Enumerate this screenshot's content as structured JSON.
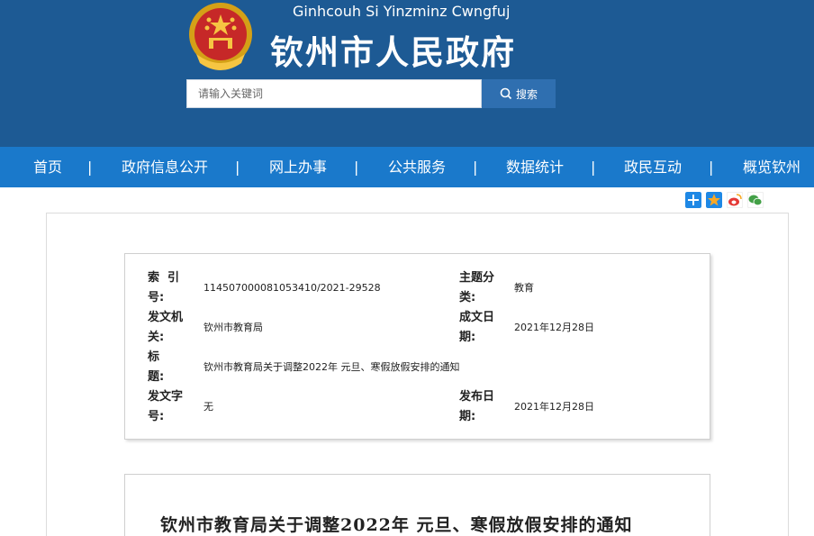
{
  "header": {
    "site_name_en": "Ginhcouh Si Yinzminz Cwngfuj",
    "site_name_cn": "钦州市人民政府",
    "search_placeholder": "请输入关键词",
    "search_button": "搜索"
  },
  "nav": {
    "items": [
      "首页",
      "政府信息公开",
      "网上办事",
      "公共服务",
      "数据统计",
      "政民互动",
      "概览钦州"
    ],
    "separator": "|"
  },
  "share": {
    "icons": [
      "add-icon",
      "favorite-star-icon",
      "weibo-icon",
      "wechat-icon"
    ],
    "colors": [
      "#1e88e5",
      "#f9a825",
      "#e53935",
      "#43a047"
    ]
  },
  "meta": {
    "index_label_1": "索  引",
    "index_label_2": "号:",
    "index_value": "114507000081053410/2021-29528",
    "topic_label_1": "主题分",
    "topic_label_2": "类:",
    "topic_value": "教育",
    "issuer_label_1": "发文机",
    "issuer_label_2": "关:",
    "issuer_value": "钦州市教育局",
    "created_label_1": "成文日",
    "created_label_2": "期:",
    "created_value": "2021年12月28日",
    "title_label_1": "标",
    "title_label_2": "题:",
    "title_value": "钦州市教育局关于调整2022年 元旦、寒假放假安排的通知",
    "docno_label_1": "发文字",
    "docno_label_2": "号:",
    "docno_value": "无",
    "published_label_1": "发布日",
    "published_label_2": "期:",
    "published_value": "2021年12月28日"
  },
  "document": {
    "title": "钦州市教育局关于调整2022年 元旦、寒假放假安排的通知"
  },
  "colors": {
    "header_bg": "#1d5a94",
    "nav_bg": "#1a79cb",
    "search_button_bg": "#2f6fb0"
  }
}
